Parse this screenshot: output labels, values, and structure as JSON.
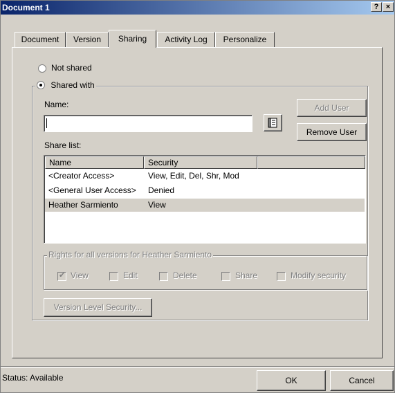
{
  "window": {
    "title": "Document 1",
    "help_label": "?",
    "close_label": "×"
  },
  "tabs": [
    {
      "label": "Document"
    },
    {
      "label": "Version"
    },
    {
      "label": "Sharing",
      "active": true
    },
    {
      "label": "Activity Log"
    },
    {
      "label": "Personalize"
    }
  ],
  "sharing": {
    "not_shared_label": "Not shared",
    "shared_with_label": "Shared with",
    "selected_option": "Shared with",
    "name_label": "Name:",
    "name_value": "",
    "add_user_label": "Add User",
    "remove_user_label": "Remove User",
    "address_book_icon": "address-book-icon",
    "share_list_label": "Share list:",
    "columns": [
      "Name",
      "Security"
    ],
    "rows": [
      {
        "name": "<Creator Access>",
        "security": "View, Edit, Del, Shr, Mod"
      },
      {
        "name": "<General User Access>",
        "security": "Denied"
      },
      {
        "name": "Heather Sarmiento",
        "security": "View",
        "selected": true
      }
    ],
    "rights_legend": "Rights for all versions for Heather Sarmiento",
    "rights": [
      {
        "label": "View",
        "checked": true
      },
      {
        "label": "Edit",
        "checked": false
      },
      {
        "label": "Delete",
        "checked": false
      },
      {
        "label": "Share",
        "checked": false
      },
      {
        "label": "Modify security",
        "checked": false
      }
    ],
    "version_level_security_label": "Version Level Security..."
  },
  "status": {
    "text": "Status: Available"
  },
  "footer": {
    "ok_label": "OK",
    "cancel_label": "Cancel"
  }
}
